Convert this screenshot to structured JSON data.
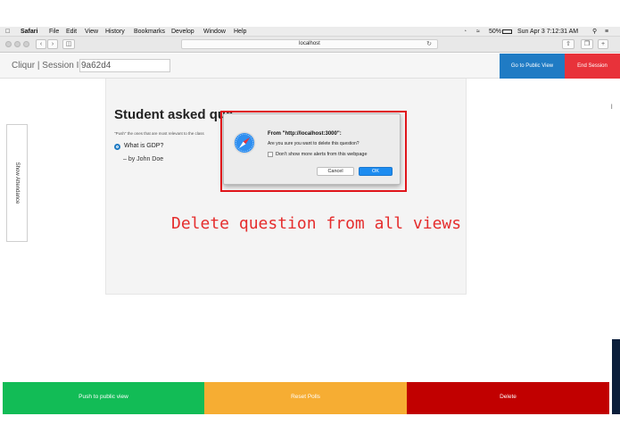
{
  "menubar": {
    "app": "Safari",
    "items": [
      "File",
      "Edit",
      "View",
      "History",
      "Bookmarks",
      "Develop",
      "Window",
      "Help"
    ],
    "battery": "50%",
    "clock": "Sun Apr 3  7:12:31 AM"
  },
  "browser": {
    "address": "localhost"
  },
  "header": {
    "title": "Cliqur | Session ID:",
    "session_id": "9a62d4",
    "public_view_label": "Go to Public View",
    "end_session_label": "End Session"
  },
  "sidebar": {
    "attendance_label": "Show Attendance"
  },
  "panel": {
    "heading": "Student asked que",
    "hint": "\"Push\" the ones that are most relevant to the class",
    "question": "What is GDP?",
    "author": "– by John Doe"
  },
  "dialog": {
    "title": "From \"http://localhost:3000\":",
    "message": "Are you sure you want to delete this question?",
    "checkbox_label": "Don't show more alerts from this webpage",
    "cancel_label": "Cancel",
    "ok_label": "OK"
  },
  "caption": "Delete question from all views",
  "footer": {
    "push_label": "Push to public view",
    "reset_label": "Reset Polls",
    "delete_label": "Delete"
  },
  "colors": {
    "blue": "#1f7bc4",
    "red": "#e8323a",
    "green": "#12bc56",
    "orange": "#f6ad33",
    "dark_red": "#c10000",
    "caption_red": "#e52d2d"
  }
}
